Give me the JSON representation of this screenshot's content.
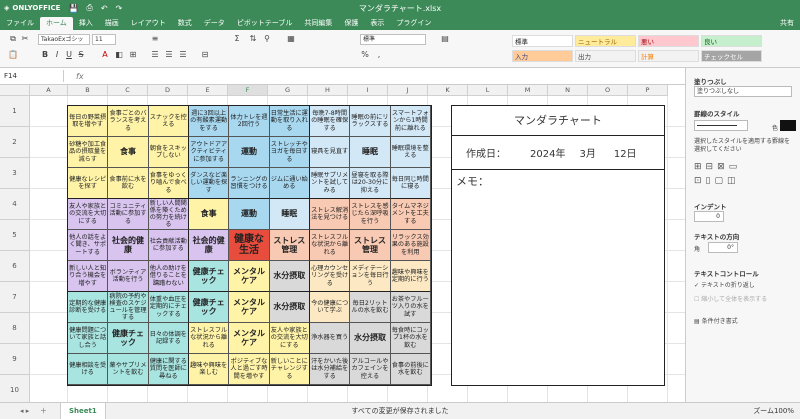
{
  "app": {
    "brand": "ONLYOFFICE",
    "title": "マンダラチャート.xlsx"
  },
  "menu": {
    "tabs": [
      "ファイル",
      "ホーム",
      "挿入",
      "描画",
      "レイアウト",
      "数式",
      "データ",
      "ピボットテーブル",
      "共同編集",
      "保護",
      "表示",
      "プラグイン"
    ],
    "active": "ホーム",
    "share": "共有"
  },
  "toolbar": {
    "font_name": "TakaoExゴシッ",
    "font_size": "11",
    "number_format": "標準",
    "cell_styles": [
      {
        "label": "標準",
        "bg": "#ffffff",
        "color": "#222"
      },
      {
        "label": "ニュートラル",
        "bg": "#ffeb9c",
        "color": "#9c6500"
      },
      {
        "label": "悪い",
        "bg": "#ffc7ce",
        "color": "#9c0006"
      },
      {
        "label": "良い",
        "bg": "#c6efce",
        "color": "#006100"
      },
      {
        "label": "入力",
        "bg": "#ffcc99",
        "color": "#3f3f76"
      },
      {
        "label": "出力",
        "bg": "#f2f2f2",
        "color": "#3f3f3f"
      },
      {
        "label": "計算",
        "bg": "#f2f2f2",
        "color": "#fa7d00"
      },
      {
        "label": "チェックセル",
        "bg": "#a5a5a5",
        "color": "#ffffff"
      }
    ]
  },
  "formula": {
    "cell_ref": "F14",
    "fx": "fx",
    "value": ""
  },
  "columns": [
    "A",
    "B",
    "C",
    "D",
    "E",
    "F",
    "G",
    "H",
    "I",
    "J",
    "K",
    "L",
    "M",
    "N",
    "O",
    "P"
  ],
  "selected_column": "F",
  "rows": [
    "1",
    "2",
    "3",
    "4",
    "5",
    "6",
    "7",
    "8",
    "9",
    "10"
  ],
  "mandala": {
    "cells": [
      [
        "毎日の野菜摂取を増やす",
        "食事ごとのバランスを考える",
        "スナックを控える",
        "週に3回以上の有酸素運動をする",
        "体力トレを週2回行う",
        "日常生活に運動を取り入れる",
        "毎晩7-8時間の睡眠を確保する",
        "睡眠の前にリラックスする",
        "スマートフォンから1時間前に離れる"
      ],
      [
        "砂糖や加工食品の摂取量を減らす",
        "食事",
        "朝食をスキップしない",
        "アウトドアアクティビティに参加する",
        "運動",
        "ストレッチやヨガを毎日する",
        "寝具を見直す",
        "睡眠",
        "睡眠環境を整える"
      ],
      [
        "健康なレシピを探す",
        "食事前に水を飲む",
        "食事をゆっくり嚙んで食べる",
        "ダンスなど楽しい運動を探す",
        "ランニングの習慣をつける",
        "ジムに通い始める",
        "睡眠サプリメントを試してみる",
        "昼寝を取る際は20-30分に抑える",
        "毎日同じ時間に寝る"
      ],
      [
        "友人や家族との交流を大切にする",
        "コミュニティ活動に参加する",
        "新しい人間関係を築くための努力を続ける",
        "食事",
        "運動",
        "睡眠",
        "ストレス解消法を見つける",
        "ストレスを感じたら深呼吸を行う",
        "タイムマネジメントを工夫する"
      ],
      [
        "他人の話をよく聞き、サポートする",
        "社会的健康",
        "社会貢献活動に参加する",
        "社会的健康",
        "健康な生活",
        "ストレス管理",
        "ストレスフルな状況から離れる",
        "ストレス管理",
        "リラックス効果のある施設を利用"
      ],
      [
        "新しい人と知り合う機会を増やす",
        "ボランティア活動を行う",
        "他人の助けを借りることを躊躇わない",
        "健康チェック",
        "メンタルケア",
        "水分摂取",
        "心理カウンセリングを受ける",
        "メディテーションを毎日行う",
        "趣味や興味を定期的に行う"
      ],
      [
        "定期的な健康診断を受ける",
        "病院の予約や検査のスケジュールを管理する",
        "体重や血圧を定期的にチェックする",
        "健康チェック",
        "メンタルケア",
        "水分摂取",
        "今の健康について学ぶ",
        "毎日2リットルの水を飲む",
        "お茶やフルーツ入りの水を試す"
      ],
      [
        "健康問題について家族と話し合う",
        "健康チェック",
        "日々の体調を記録する",
        "ストレスフルな状況から離れる",
        "メンタルケア",
        "友人や家族との交流を大切にする",
        "浄水器を買う",
        "水分摂取",
        "毎食時にコップ1杯の水を飲む"
      ],
      [
        "健康相談を受ける",
        "薬やサプリメントを飲む",
        "健康に関する質問を医師に尋ねる",
        "趣味や興味を楽しむ",
        "ポジティブな人と過ごす時間を増やす",
        "新しいことにチャレンジする",
        "汗をかいた後は水分補給をする",
        "アルコールやカフェインを控える",
        "食事の前後に水を飲む"
      ]
    ],
    "colors": [
      [
        "#fff3a8",
        "#fff3a8",
        "#fff3a8",
        "#a8d8f0",
        "#a8d8f0",
        "#a8d8f0",
        "#d2e8f7",
        "#d2e8f7",
        "#d2e8f7"
      ],
      [
        "#fff3a8",
        "#fff3a8",
        "#fff3a8",
        "#a8d8f0",
        "#a8d8f0",
        "#a8d8f0",
        "#d2e8f7",
        "#d2e8f7",
        "#d2e8f7"
      ],
      [
        "#fff3a8",
        "#fff3a8",
        "#fff3a8",
        "#a8d8f0",
        "#a8d8f0",
        "#a8d8f0",
        "#d2e8f7",
        "#d2e8f7",
        "#d2e8f7"
      ],
      [
        "#d8c4ef",
        "#d8c4ef",
        "#d8c4ef",
        "#fff3a8",
        "#a8d8f0",
        "#d2e8f7",
        "#f8c9b3",
        "#f8c9b3",
        "#f8c9b3"
      ],
      [
        "#d8c4ef",
        "#d8c4ef",
        "#d8c4ef",
        "#d8c4ef",
        "#e84c3d",
        "#f8c9b3",
        "#f8c9b3",
        "#f8c9b3",
        "#f8c9b3"
      ],
      [
        "#d8c4ef",
        "#d8c4ef",
        "#d8c4ef",
        "#a8e4e0",
        "#fff3a8",
        "#d9d9d9",
        "#fce9c4",
        "#fce9c4",
        "#fce9c4"
      ],
      [
        "#a8e4e0",
        "#a8e4e0",
        "#a8e4e0",
        "#a8e4e0",
        "#fff3a8",
        "#d9d9d9",
        "#fce9c4",
        "#d9d9d9",
        "#d9d9d9"
      ],
      [
        "#a8e4e0",
        "#a8e4e0",
        "#a8e4e0",
        "#fff3a8",
        "#fff3a8",
        "#fff3a8",
        "#d9d9d9",
        "#d9d9d9",
        "#d9d9d9"
      ],
      [
        "#a8e4e0",
        "#a8e4e0",
        "#a8e4e0",
        "#fff3a8",
        "#fff3a8",
        "#fff3a8",
        "#d9d9d9",
        "#d9d9d9",
        "#d9d9d9"
      ]
    ]
  },
  "memo_sheet": {
    "title": "マンダラチャート",
    "date_label": "作成日：",
    "year": "2024年",
    "month": "3月",
    "day": "12日",
    "memo_label": "メモ："
  },
  "right_panel": {
    "fill_heading": "塗りつぶし",
    "fill_value": "塗りつぶしなし",
    "border_heading": "罫線のスタイル",
    "border_color_label": "色",
    "border_help": "選択したスタイルを適用する罫線を選択してください",
    "indent_heading": "インデント",
    "indent_value": "0",
    "direction_heading": "テキストの方向",
    "angle_label": "角",
    "angle_value": "0°",
    "control_heading": "テキストコントロール",
    "wrap_label": "テキストの折り返し",
    "shrink_label": "縮小して全体を表示する",
    "cond_format": "条件付き書式"
  },
  "status": {
    "sheet_tab": "Sheet1",
    "message": "すべての変更が保存されました",
    "zoom": "ズーム100%"
  }
}
